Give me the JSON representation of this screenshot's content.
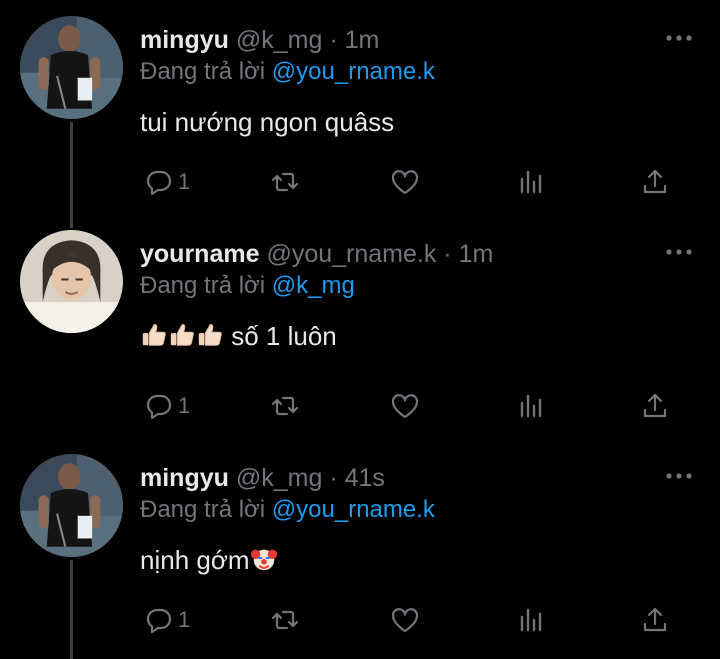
{
  "colors": {
    "background": "#000000",
    "text": "#e7e9ea",
    "muted": "#71767b",
    "mention": "#1d9bf0",
    "thread_line": "#3e4144"
  },
  "tweets": [
    {
      "name": "mingyu",
      "handle": "@k_mg",
      "separator": "·",
      "time": "1m",
      "reply_prefix": "Đang trả lời",
      "reply_to": "@you_rname.k",
      "text": "tui nướng ngon quâss",
      "emoji": [],
      "reply_count": "1",
      "icons": [
        "reply-icon",
        "retweet-icon",
        "like-icon",
        "views-icon",
        "share-icon",
        "more-icon"
      ]
    },
    {
      "name": "yourname",
      "handle": "@you_rname.k",
      "separator": "·",
      "time": "1m",
      "reply_prefix": "Đang trả lời",
      "reply_to": "@k_mg",
      "text": "số 1 luôn",
      "emoji": [
        "👍🏻",
        "👍🏻",
        "👍🏻"
      ],
      "reply_count": "1",
      "icons": [
        "reply-icon",
        "retweet-icon",
        "like-icon",
        "views-icon",
        "share-icon",
        "more-icon"
      ]
    },
    {
      "name": "mingyu",
      "handle": "@k_mg",
      "separator": "·",
      "time": "41s",
      "reply_prefix": "Đang trả lời",
      "reply_to": "@you_rname.k",
      "text": "nịnh gớm",
      "emoji": [
        "🤡"
      ],
      "reply_count": "1",
      "icons": [
        "reply-icon",
        "retweet-icon",
        "like-icon",
        "views-icon",
        "share-icon",
        "more-icon"
      ]
    }
  ]
}
